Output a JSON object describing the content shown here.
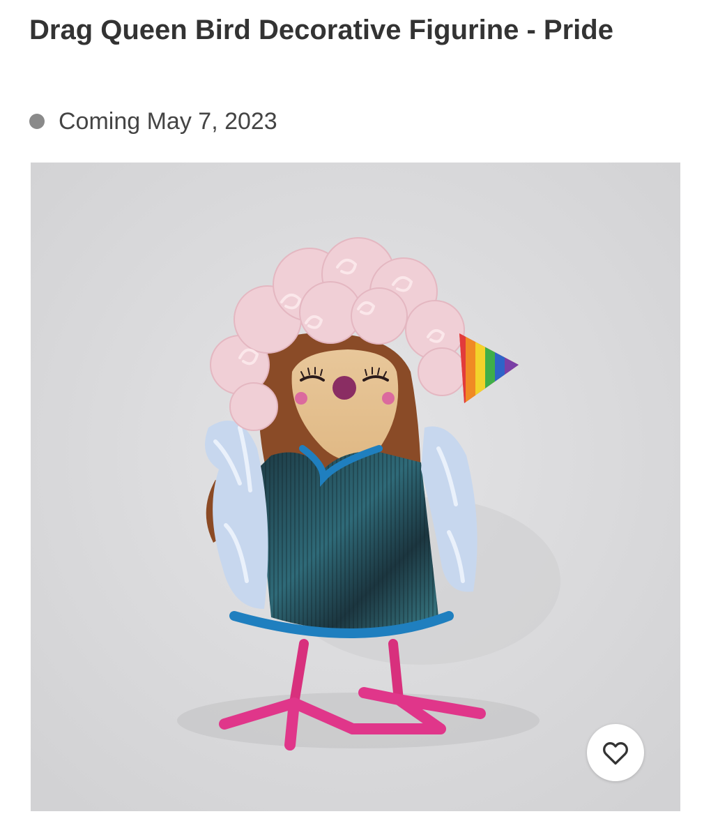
{
  "product": {
    "title": "Drag Queen Bird Decorative Figurine - Pride",
    "availability": "Coming May 7, 2023",
    "image_background": "#dcdcdc"
  },
  "actions": {
    "favorite_icon": "heart-outline-icon"
  },
  "colors": {
    "title_text": "#333333",
    "status_dot": "#8a8a8a",
    "favorite_button_bg": "#ffffff"
  }
}
